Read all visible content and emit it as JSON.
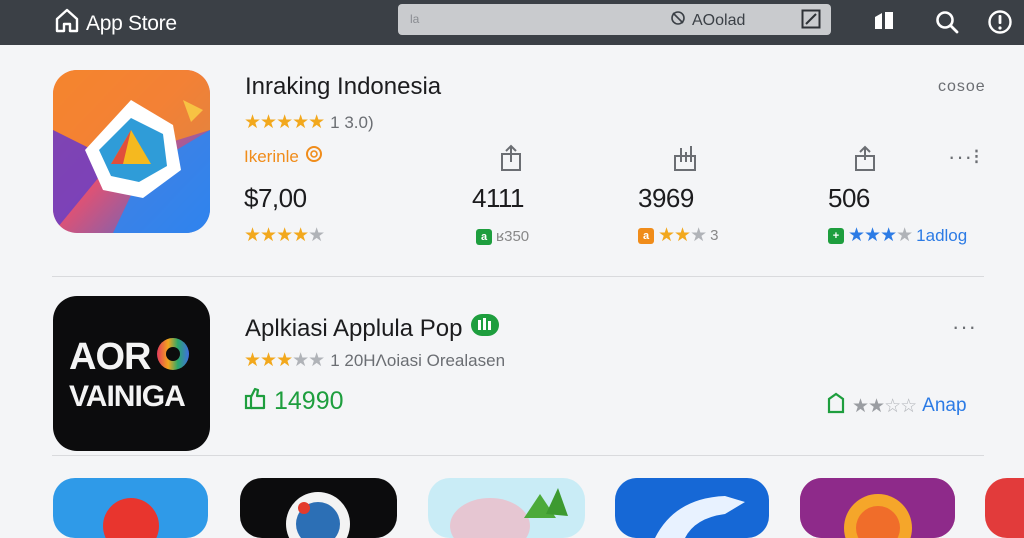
{
  "topbar": {
    "logo_text": "App Store",
    "search_placeholder": "la",
    "search_center": "AOolad"
  },
  "card1": {
    "title": "Inraking Indonesia",
    "rating_count": "1 3.0)",
    "publisher": "Ikerinle",
    "more_label": "cosoe",
    "stats": [
      {
        "value": "$7,00",
        "stars": 4,
        "sub": ""
      },
      {
        "value": "4111",
        "badge": "a",
        "sub": "ʁ350"
      },
      {
        "value": "3969",
        "badge": "a",
        "stars": 3,
        "sub": "3"
      },
      {
        "value": "506",
        "badge": "+",
        "stars": 4,
        "sub": "1adlog"
      }
    ]
  },
  "card2": {
    "title": "Aplkiasi Applula Pop",
    "icon_text_top": "AOR",
    "icon_text_bottom": "VAINIGA",
    "rating_text": "1 20ΗΛoiasi Orealasen",
    "count": "14990",
    "action_label": "Anap"
  },
  "colors": {
    "topbar": "#3b4046",
    "star": "#f2a81d",
    "green": "#1e9e3e",
    "blue": "#2c7be5"
  }
}
